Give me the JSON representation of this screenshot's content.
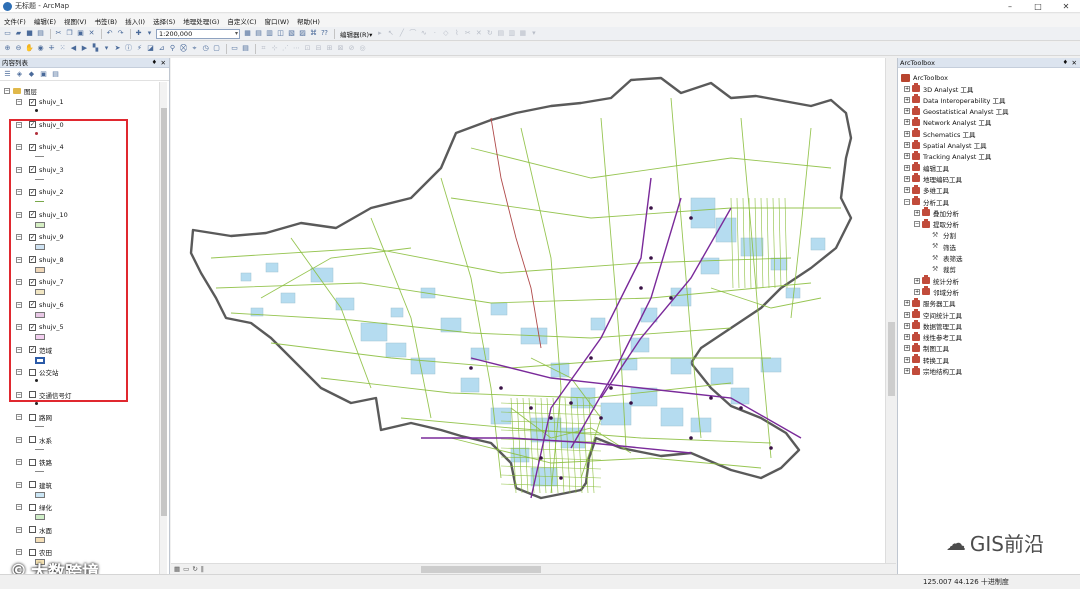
{
  "window": {
    "title": "无标题 - ArcMap",
    "minimize": "–",
    "maximize": "□",
    "close": "✕"
  },
  "menu": [
    "文件(F)",
    "编辑(E)",
    "视图(V)",
    "书签(B)",
    "插入(I)",
    "选择(S)",
    "地理处理(G)",
    "自定义(C)",
    "窗口(W)",
    "帮助(H)"
  ],
  "toolbar": {
    "scale": "1:200,000",
    "editor_label": "编辑器(R)▾"
  },
  "toc": {
    "title": "内容列表",
    "pin": "♦",
    "close": "✕",
    "group": "图层",
    "layers": [
      {
        "name": "shujv_1",
        "checked": true,
        "symbol": "dot"
      },
      {
        "name": "shujv_0",
        "checked": true,
        "symbol": "dot-red"
      },
      {
        "name": "shujv_4",
        "checked": true,
        "symbol": "line"
      },
      {
        "name": "shujv_3",
        "checked": true,
        "symbol": "line"
      },
      {
        "name": "shujv_2",
        "checked": true,
        "symbol": "line-green"
      },
      {
        "name": "shujv_10",
        "checked": true,
        "symbol": "poly",
        "fill": "#d6efc4"
      },
      {
        "name": "shujv_9",
        "checked": true,
        "symbol": "poly",
        "fill": "#cfe3f3"
      },
      {
        "name": "shujv_8",
        "checked": true,
        "symbol": "poly",
        "fill": "#f0d7b8"
      },
      {
        "name": "shujv_7",
        "checked": true,
        "symbol": "poly",
        "fill": "#f1e6c3"
      },
      {
        "name": "shujv_6",
        "checked": true,
        "symbol": "poly",
        "fill": "#e9c8e6"
      },
      {
        "name": "shujv_5",
        "checked": true,
        "symbol": "poly",
        "fill": "#f3cff0"
      },
      {
        "name": "范域",
        "checked": true,
        "symbol": "poly-outline",
        "fill": "#ffffff"
      },
      {
        "name": "公交站",
        "checked": false,
        "symbol": "dot"
      },
      {
        "name": "交通信号灯",
        "checked": false,
        "symbol": "dot"
      },
      {
        "name": "路网",
        "checked": false,
        "symbol": "line"
      },
      {
        "name": "水系",
        "checked": false,
        "symbol": "line"
      },
      {
        "name": "铁路",
        "checked": false,
        "symbol": "line"
      },
      {
        "name": "建筑",
        "checked": false,
        "symbol": "poly",
        "fill": "#cbe6f5"
      },
      {
        "name": "绿化",
        "checked": false,
        "symbol": "poly",
        "fill": "#cfeec8"
      },
      {
        "name": "水面",
        "checked": false,
        "symbol": "poly",
        "fill": "#f5dfb8"
      },
      {
        "name": "农田",
        "checked": false,
        "symbol": "poly",
        "fill": "#f6e3b3"
      }
    ]
  },
  "toolbox": {
    "title": "ArcToolbox",
    "pin": "♦",
    "close": "✕",
    "root": "ArcToolbox",
    "items": [
      {
        "label": "3D Analyst 工具",
        "level": 1,
        "kind": "box",
        "exp": "+"
      },
      {
        "label": "Data Interoperability 工具",
        "level": 1,
        "kind": "box",
        "exp": "+"
      },
      {
        "label": "Geostatistical Analyst 工具",
        "level": 1,
        "kind": "box",
        "exp": "+"
      },
      {
        "label": "Network Analyst 工具",
        "level": 1,
        "kind": "box",
        "exp": "+"
      },
      {
        "label": "Schematics 工具",
        "level": 1,
        "kind": "box",
        "exp": "+"
      },
      {
        "label": "Spatial Analyst 工具",
        "level": 1,
        "kind": "box",
        "exp": "+"
      },
      {
        "label": "Tracking Analyst 工具",
        "level": 1,
        "kind": "box",
        "exp": "+"
      },
      {
        "label": "编辑工具",
        "level": 1,
        "kind": "box",
        "exp": "+"
      },
      {
        "label": "地理编码工具",
        "level": 1,
        "kind": "box",
        "exp": "+"
      },
      {
        "label": "多维工具",
        "level": 1,
        "kind": "box",
        "exp": "+"
      },
      {
        "label": "分析工具",
        "level": 1,
        "kind": "box",
        "exp": "−"
      },
      {
        "label": "叠加分析",
        "level": 2,
        "kind": "box",
        "exp": "+"
      },
      {
        "label": "提取分析",
        "level": 2,
        "kind": "box",
        "exp": "−"
      },
      {
        "label": "分割",
        "level": 3,
        "kind": "tool",
        "exp": ""
      },
      {
        "label": "筛选",
        "level": 3,
        "kind": "tool",
        "exp": ""
      },
      {
        "label": "表筛选",
        "level": 3,
        "kind": "tool",
        "exp": ""
      },
      {
        "label": "裁剪",
        "level": 3,
        "kind": "tool",
        "exp": ""
      },
      {
        "label": "统计分析",
        "level": 2,
        "kind": "box",
        "exp": "+"
      },
      {
        "label": "邻域分析",
        "level": 2,
        "kind": "box",
        "exp": "+"
      },
      {
        "label": "服务器工具",
        "level": 1,
        "kind": "box",
        "exp": "+"
      },
      {
        "label": "空间统计工具",
        "level": 1,
        "kind": "box",
        "exp": "+"
      },
      {
        "label": "数据管理工具",
        "level": 1,
        "kind": "box",
        "exp": "+"
      },
      {
        "label": "线性参考工具",
        "level": 1,
        "kind": "box",
        "exp": "+"
      },
      {
        "label": "制图工具",
        "level": 1,
        "kind": "box",
        "exp": "+"
      },
      {
        "label": "转换工具",
        "level": 1,
        "kind": "box",
        "exp": "+"
      },
      {
        "label": "宗地结构工具",
        "level": 1,
        "kind": "box",
        "exp": "+"
      }
    ]
  },
  "status": {
    "coords": "125.007  44.126 十进制度"
  },
  "watermarks": {
    "right": "GIS前沿",
    "left": "大数跨境",
    "right_icon": "☁",
    "left_icon": "©"
  },
  "colors": {
    "outline": "#5a5a5a",
    "roads": "#8cbf3f",
    "water": "#a9d6ee",
    "railway": "#7a2a9a",
    "river": "#b04a4a",
    "frame": "#e0282f"
  }
}
